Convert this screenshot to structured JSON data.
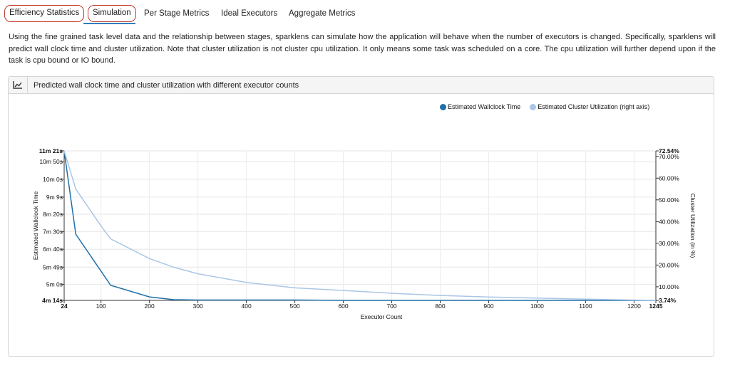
{
  "tabs": [
    {
      "label": "Efficiency Statistics",
      "circled": true,
      "active": false
    },
    {
      "label": "Simulation",
      "circled": true,
      "active": true
    },
    {
      "label": "Per Stage Metrics",
      "circled": false,
      "active": false
    },
    {
      "label": "Ideal Executors",
      "circled": false,
      "active": false
    },
    {
      "label": "Aggregate Metrics",
      "circled": false,
      "active": false
    }
  ],
  "description": "Using the fine grained task level data and the relationship between stages, sparklens can simulate how the application will behave when the number of executors is changed. Specifically, sparklens will predict wall clock time and cluster utilization. Note that cluster utilization is not cluster cpu utilization. It only means some task was scheduled on a core. The cpu utilization will further depend upon if the task is cpu bound or IO bound.",
  "panel": {
    "title": "Predicted wall clock time and cluster utilization with different executor counts",
    "icon": "line-chart-icon"
  },
  "colors": {
    "wallclock": "#1f6fa8",
    "utilization": "#a9c6e6",
    "highlight": "#c0392b",
    "tab_underline": "#2f7ebf"
  },
  "chart_data": {
    "type": "line",
    "title": "",
    "xlabel": "Executor Count",
    "ylabel": "Estimated Wallclock Time",
    "y2label": "Cluster Utilization (in %)",
    "legend_position": "top-right",
    "xlim": [
      24,
      1245
    ],
    "ylim_seconds": [
      254,
      681
    ],
    "y2lim": [
      3.74,
      72.54
    ],
    "x_ticks": [
      {
        "value": 24,
        "label": "24",
        "bold": true
      },
      {
        "value": 100,
        "label": "100"
      },
      {
        "value": 200,
        "label": "200"
      },
      {
        "value": 300,
        "label": "300"
      },
      {
        "value": 400,
        "label": "400"
      },
      {
        "value": 500,
        "label": "500"
      },
      {
        "value": 600,
        "label": "600"
      },
      {
        "value": 700,
        "label": "700"
      },
      {
        "value": 800,
        "label": "800"
      },
      {
        "value": 900,
        "label": "900"
      },
      {
        "value": 1000,
        "label": "1000"
      },
      {
        "value": 1100,
        "label": "1100"
      },
      {
        "value": 1200,
        "label": "1200"
      },
      {
        "value": 1245,
        "label": "1245",
        "bold": true
      }
    ],
    "y_ticks": [
      {
        "value": 681,
        "label": "11m 21s",
        "bold": true
      },
      {
        "value": 650,
        "label": "10m 50s"
      },
      {
        "value": 600,
        "label": "10m 0s"
      },
      {
        "value": 549,
        "label": "9m 9s"
      },
      {
        "value": 500,
        "label": "8m 20s"
      },
      {
        "value": 450,
        "label": "7m 30s"
      },
      {
        "value": 400,
        "label": "6m 40s"
      },
      {
        "value": 349,
        "label": "5m 49s"
      },
      {
        "value": 300,
        "label": "5m 0s"
      },
      {
        "value": 254,
        "label": "4m 14s",
        "bold": true
      }
    ],
    "y2_ticks": [
      {
        "value": 72.54,
        "label": "72.54%",
        "bold": true
      },
      {
        "value": 70,
        "label": "70.00%"
      },
      {
        "value": 60,
        "label": "60.00%"
      },
      {
        "value": 50,
        "label": "50.00%"
      },
      {
        "value": 40,
        "label": "40.00%"
      },
      {
        "value": 30,
        "label": "30.00%"
      },
      {
        "value": 20,
        "label": "20.00%"
      },
      {
        "value": 10,
        "label": "10.00%"
      },
      {
        "value": 3.74,
        "label": "3.74%",
        "bold": true
      }
    ],
    "series": [
      {
        "name": "Estimated Wallclock Time",
        "axis": "left",
        "x": [
          24,
          48,
          120,
          200,
          250,
          300,
          400,
          500,
          600,
          700,
          800,
          900,
          1000,
          1100,
          1200,
          1245
        ],
        "y": [
          681,
          443,
          297,
          264,
          256,
          255,
          255,
          255,
          254,
          254,
          254,
          254,
          254,
          254,
          254,
          254
        ]
      },
      {
        "name": "Estimated Cluster Utilization (right axis)",
        "axis": "right",
        "x": [
          24,
          48,
          100,
          120,
          200,
          250,
          300,
          400,
          500,
          600,
          700,
          800,
          900,
          1000,
          1100,
          1200,
          1245
        ],
        "y": [
          72.54,
          55,
          38,
          32,
          23,
          19,
          16,
          12,
          9.5,
          8.3,
          7,
          6,
          5.3,
          4.8,
          4.3,
          3.9,
          3.74
        ]
      }
    ]
  }
}
